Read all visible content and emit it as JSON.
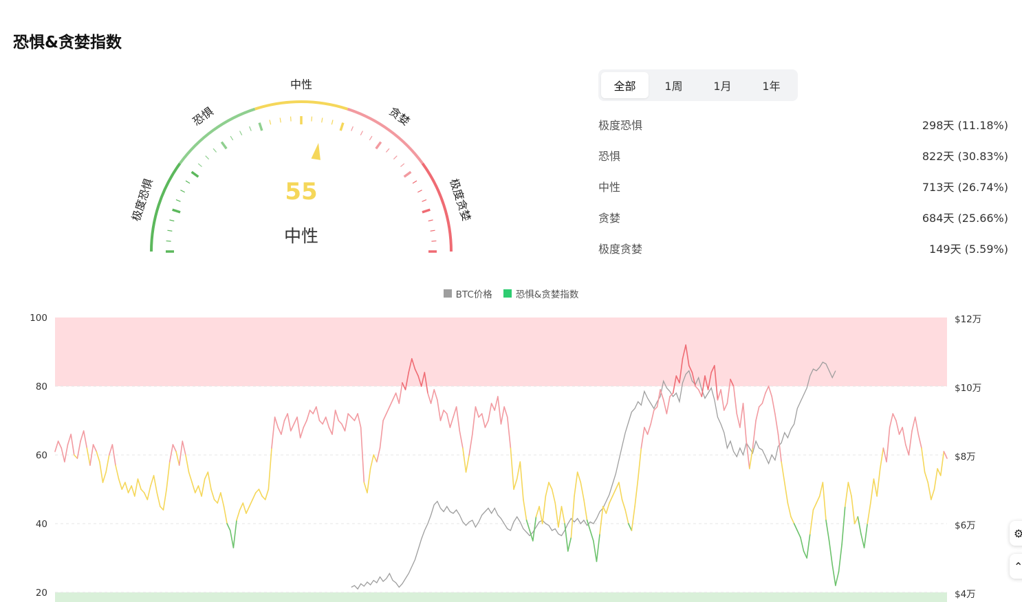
{
  "page": {
    "title": "恐惧&贪婪指数"
  },
  "gauge": {
    "value": "55",
    "label": "中性",
    "zones": [
      {
        "label": "极度恐惧",
        "color": "#5cb85c",
        "range": [
          0,
          20
        ]
      },
      {
        "label": "恐惧",
        "color": "#8fcf8f",
        "range": [
          20,
          40
        ]
      },
      {
        "label": "中性",
        "color": "#f5d75a",
        "range": [
          40,
          60
        ]
      },
      {
        "label": "贪婪",
        "color": "#f29aa0",
        "range": [
          60,
          80
        ]
      },
      {
        "label": "极度贪婪",
        "color": "#ef6b73",
        "range": [
          80,
          100
        ]
      }
    ]
  },
  "tabs": [
    {
      "label": "全部",
      "active": true
    },
    {
      "label": "1周",
      "active": false
    },
    {
      "label": "1月",
      "active": false
    },
    {
      "label": "1年",
      "active": false
    }
  ],
  "stats": [
    {
      "label": "极度恐惧",
      "value": "298天 (11.18%)"
    },
    {
      "label": "恐惧",
      "value": "822天 (30.83%)"
    },
    {
      "label": "中性",
      "value": "713天 (26.74%)"
    },
    {
      "label": "贪婪",
      "value": "684天 (25.66%)"
    },
    {
      "label": "极度贪婪",
      "value": "149天 (5.59%)"
    }
  ],
  "chart_data": {
    "type": "line",
    "legend": [
      {
        "label": "BTC价格",
        "color": "#9e9e9e"
      },
      {
        "label": "恐惧&贪婪指数",
        "color": "#2ecc71"
      }
    ],
    "left_axis": {
      "ticks": [
        "100",
        "80",
        "60",
        "40",
        "20"
      ],
      "values": [
        100,
        80,
        60,
        40,
        20
      ],
      "range": [
        20,
        100
      ]
    },
    "right_axis": {
      "ticks": [
        "$12万",
        "$10万",
        "$8万",
        "$6万",
        "$4万"
      ],
      "values": [
        120000,
        100000,
        80000,
        60000,
        40000
      ],
      "range": [
        40000,
        120000
      ]
    },
    "bands": [
      {
        "from": 80,
        "to": 100,
        "color": "#ffdcdf"
      },
      {
        "from": 0,
        "to": 20,
        "color": "#d9f0d9"
      }
    ],
    "colors": {
      "extreme_greed": "#ef6b73",
      "greed": "#f29aa0",
      "neutral": "#f5d75a",
      "fear": "#6cc26c",
      "btc": "#9e9e9e"
    },
    "series": [
      {
        "name": "恐惧&贪婪指数",
        "values": [
          61,
          64,
          62,
          58,
          63,
          66,
          60,
          59,
          64,
          67,
          62,
          57,
          63,
          61,
          58,
          52,
          55,
          60,
          63,
          57,
          53,
          50,
          52,
          49,
          51,
          48,
          53,
          50,
          49,
          47,
          51,
          54,
          49,
          45,
          44,
          50,
          58,
          63,
          61,
          57,
          64,
          60,
          55,
          52,
          49,
          51,
          48,
          53,
          55,
          50,
          47,
          46,
          49,
          45,
          40,
          38,
          33,
          41,
          44,
          46,
          43,
          45,
          47,
          49,
          50,
          48,
          47,
          50,
          62,
          71,
          68,
          66,
          70,
          72,
          67,
          69,
          71,
          65,
          68,
          70,
          73,
          72,
          74,
          70,
          69,
          71,
          68,
          66,
          73,
          70,
          69,
          67,
          72,
          71,
          70,
          72,
          68,
          52,
          49,
          56,
          60,
          58,
          62,
          70,
          72,
          74,
          76,
          78,
          75,
          81,
          79,
          84,
          88,
          85,
          83,
          80,
          84,
          78,
          75,
          79,
          76,
          70,
          73,
          72,
          68,
          71,
          74,
          67,
          62,
          55,
          60,
          66,
          74,
          71,
          72,
          68,
          70,
          75,
          73,
          77,
          69,
          74,
          71,
          62,
          50,
          53,
          58,
          47,
          41,
          38,
          35,
          42,
          45,
          40,
          48,
          52,
          50,
          46,
          39,
          45,
          40,
          32,
          36,
          48,
          55,
          52,
          47,
          41,
          38,
          35,
          29,
          37,
          45,
          43,
          46,
          48,
          50,
          52,
          47,
          44,
          40,
          38,
          45,
          53,
          62,
          68,
          66,
          69,
          73,
          74,
          79,
          76,
          72,
          77,
          78,
          83,
          81,
          88,
          92,
          86,
          84,
          80,
          79,
          77,
          83,
          79,
          84,
          86,
          76,
          79,
          73,
          75,
          82,
          80,
          72,
          68,
          75,
          64,
          56,
          62,
          70,
          74,
          75,
          78,
          80,
          77,
          72,
          66,
          58,
          52,
          46,
          42,
          40,
          38,
          36,
          32,
          30,
          37,
          44,
          46,
          48,
          52,
          41,
          35,
          28,
          22,
          26,
          34,
          45,
          52,
          48,
          40,
          42,
          37,
          33,
          40,
          46,
          53,
          48,
          56,
          62,
          58,
          68,
          72,
          70,
          66,
          68,
          63,
          60,
          67,
          71,
          66,
          62,
          55,
          52,
          47,
          50,
          56,
          54,
          61,
          59
        ]
      },
      {
        "name": "BTC价格",
        "values": [
          40000,
          40000,
          40000,
          40000,
          40000,
          40000,
          40000,
          40000,
          40000,
          40000,
          40000,
          40000,
          40000,
          40000,
          40000,
          40000,
          40000,
          40000,
          40000,
          40000,
          40000,
          40000,
          40000,
          40000,
          40000,
          40000,
          40000,
          40000,
          40000,
          40000,
          40000,
          40000,
          40000,
          40000,
          40000,
          40000,
          40000,
          40000,
          40000,
          40000,
          40000,
          40000,
          40000,
          40000,
          40000,
          40000,
          40000,
          40000,
          40000,
          40000,
          40000,
          40000,
          40000,
          40000,
          40000,
          40000,
          40000,
          40000,
          40000,
          40000,
          40000,
          40000,
          40000,
          40000,
          40000,
          40000,
          40000,
          40000,
          40000,
          40000,
          40000,
          40000,
          40000,
          40000,
          40000,
          40000,
          40000,
          40000,
          40000,
          40000,
          40000,
          40000,
          40000,
          40000,
          40000,
          40000,
          40000,
          40000,
          40000,
          40000,
          40000,
          40000,
          40000,
          41500,
          42000,
          41000,
          42500,
          41800,
          43000,
          42200,
          43500,
          42800,
          44500,
          43200,
          44000,
          45500,
          43500,
          42800,
          41500,
          42500,
          44000,
          45500,
          47500,
          49500,
          52500,
          55500,
          58000,
          60000,
          62500,
          65500,
          66500,
          64500,
          63500,
          65000,
          63500,
          63000,
          64000,
          62500,
          60500,
          59500,
          60500,
          61000,
          59000,
          60500,
          62500,
          63500,
          64500,
          63000,
          64500,
          62500,
          61500,
          60000,
          58500,
          58000,
          60500,
          62000,
          60500,
          58500,
          57500,
          56500,
          57500,
          59000,
          60500,
          61000,
          60000,
          59500,
          58000,
          58500,
          57000,
          56500,
          58000,
          60000,
          61500,
          60500,
          61500,
          60000,
          61000,
          59500,
          60500,
          60000,
          61500,
          63500,
          64500,
          66500,
          68500,
          71500,
          74500,
          78500,
          82500,
          86500,
          89500,
          92500,
          93500,
          95500,
          94500,
          98500,
          96500,
          95000,
          93500,
          95500,
          97000,
          101500,
          99500,
          98500,
          97000,
          98000,
          95500,
          101000,
          103500,
          104500,
          101500,
          100500,
          102500,
          99000,
          96500,
          98000,
          99500,
          96000,
          91000,
          89000,
          86500,
          82000,
          84000,
          81000,
          79500,
          82000,
          80000,
          83500,
          82000,
          80500,
          84000,
          82000,
          81500,
          79500,
          77500,
          80000,
          78500,
          82500,
          83500,
          86500,
          85000,
          87500,
          89000,
          93500,
          95500,
          97500,
          99500,
          103000,
          105000,
          104500,
          105500,
          107000,
          106500,
          104500,
          102500,
          104500
        ]
      }
    ]
  }
}
